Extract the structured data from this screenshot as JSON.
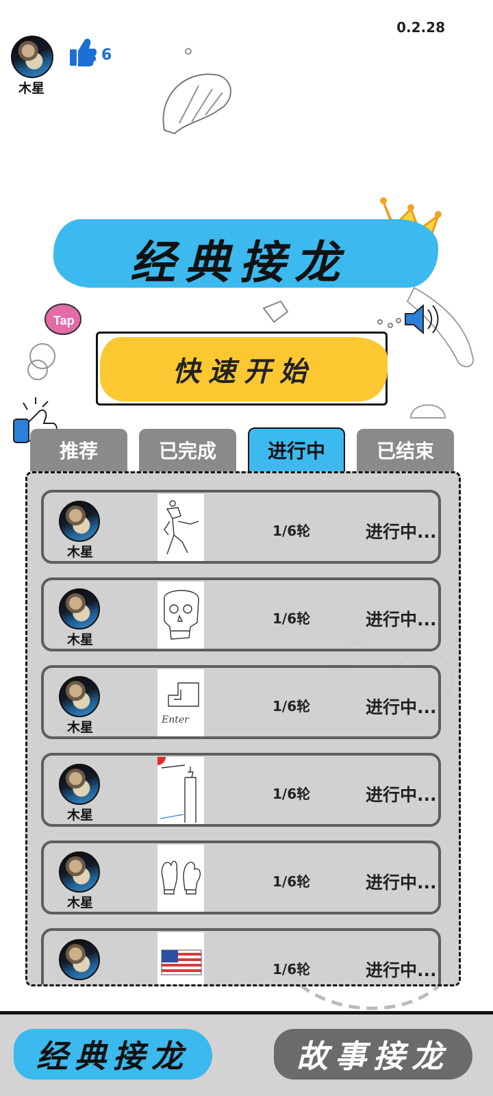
{
  "header": {
    "version": "0.2.28",
    "user": {
      "name": "木星"
    },
    "likes": {
      "count": "6",
      "icon": "thumbs-up-icon"
    }
  },
  "game": {
    "title": "经典接龙",
    "quick_start": "快速开始",
    "icons": [
      "info-icon",
      "crown-icon",
      "sound-icon"
    ]
  },
  "tabs": [
    {
      "label": "推荐",
      "active": false
    },
    {
      "label": "已完成",
      "active": false
    },
    {
      "label": "进行中",
      "active": true
    },
    {
      "label": "已结束",
      "active": false
    }
  ],
  "games_list": [
    {
      "user": "木星",
      "rounds": "1/6轮",
      "status": "进行中...",
      "drawing": "warrior sketch"
    },
    {
      "user": "木星",
      "rounds": "1/6轮",
      "status": "进行中...",
      "drawing": "skull sketch"
    },
    {
      "user": "木星",
      "rounds": "1/6轮",
      "status": "进行中...",
      "drawing": "enter key sketch",
      "drawing_text": "Enter"
    },
    {
      "user": "木星",
      "rounds": "1/6轮",
      "status": "进行中...",
      "drawing": "tower sketch"
    },
    {
      "user": "木星",
      "rounds": "1/6轮",
      "status": "进行中...",
      "drawing": "mittens sketch"
    },
    {
      "user": "",
      "rounds": "1/6轮",
      "status": "进行中...",
      "drawing": "flag sketch"
    }
  ],
  "bottom_nav": {
    "classic": "经典接龙",
    "story": "故事接龙"
  },
  "colors": {
    "accent_blue": "#3cb9ee",
    "accent_yellow": "#fbc832",
    "tab_gray": "#8a8a8a",
    "like_blue": "#1c6fd6"
  }
}
